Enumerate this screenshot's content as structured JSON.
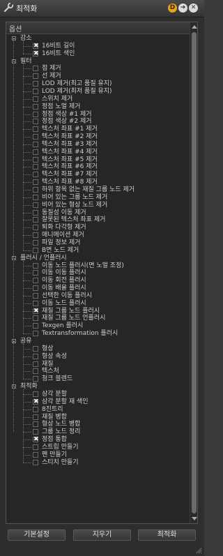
{
  "window": {
    "title": "최적화",
    "btn_d": "D",
    "btn_go": "➜",
    "btn_close": "✕"
  },
  "tree": {
    "header": "옵션",
    "groups": [
      {
        "label": "감소",
        "items": [
          {
            "label": "16비트 길이",
            "checked": true
          },
          {
            "label": "16비트 색인",
            "checked": true
          }
        ]
      },
      {
        "label": "필터",
        "items": [
          {
            "label": "점 제거",
            "checked": false
          },
          {
            "label": "선 제거",
            "checked": false
          },
          {
            "label": "LOD 제거(최고 품질 유지)",
            "checked": false
          },
          {
            "label": "LOD 제거(최저 품질 유지)",
            "checked": false
          },
          {
            "label": "스위치 제거",
            "checked": false
          },
          {
            "label": "정점 노멀 제거",
            "checked": false
          },
          {
            "label": "정점 색상 #1 제거",
            "checked": false
          },
          {
            "label": "정점 색상 #2 제거",
            "checked": false
          },
          {
            "label": "텍스처 좌표 #1 제거",
            "checked": false
          },
          {
            "label": "텍스처 좌표 #2 제거",
            "checked": false
          },
          {
            "label": "텍스처 좌표 #3 제거",
            "checked": false
          },
          {
            "label": "텍스처 좌표 #4 제거",
            "checked": false
          },
          {
            "label": "텍스처 좌표 #5 제거",
            "checked": false
          },
          {
            "label": "텍스처 좌표 #6 제거",
            "checked": false
          },
          {
            "label": "텍스처 좌표 #7 제거",
            "checked": false
          },
          {
            "label": "텍스처 좌표 #8 제거",
            "checked": false
          },
          {
            "label": "하위 항목 없는 재질 그룹 노드 제거",
            "checked": false
          },
          {
            "label": "비어 있는 그룹 노드 제거",
            "checked": false
          },
          {
            "label": "비어 있는 형상 노드 제거",
            "checked": false
          },
          {
            "label": "동질성 이동 제거",
            "checked": false
          },
          {
            "label": "잘못된 텍스처 좌표 제거",
            "checked": false
          },
          {
            "label": "퇴화 다각형 제거",
            "checked": false
          },
          {
            "label": "애니메이션 제거",
            "checked": false
          },
          {
            "label": "파일 정보 제거",
            "checked": false
          },
          {
            "label": "B면 노드 제거",
            "checked": false
          }
        ]
      },
      {
        "label": "플러시 / 언플러시",
        "items": [
          {
            "label": "이동 노드 플러시(면 노멀 조정)",
            "checked": false
          },
          {
            "label": "이동 이동 플러시",
            "checked": false
          },
          {
            "label": "이동 회전 플러시",
            "checked": false
          },
          {
            "label": "이동 배율 플러시",
            "checked": false
          },
          {
            "label": "선택한 이동 플러시",
            "checked": false
          },
          {
            "label": "이동 노드 플러시",
            "checked": false
          },
          {
            "label": "재질 그룹 노드 플러시",
            "checked": true
          },
          {
            "label": "재질 그룹 노드 언플러시",
            "checked": false
          },
          {
            "label": "Texgen 플러시",
            "checked": false
          },
          {
            "label": "Textransformation 플러시",
            "checked": false
          }
        ]
      },
      {
        "label": "공유",
        "items": [
          {
            "label": "형상",
            "checked": false
          },
          {
            "label": "형상 속성",
            "checked": false
          },
          {
            "label": "재질",
            "checked": false
          },
          {
            "label": "텍스처",
            "checked": false
          },
          {
            "label": "청크 블렌드",
            "checked": false
          }
        ]
      },
      {
        "label": "최적화",
        "items": [
          {
            "label": "삼각 분할",
            "checked": false
          },
          {
            "label": "삼각 분할 재 색인",
            "checked": true
          },
          {
            "label": "8진트리",
            "checked": false
          },
          {
            "label": "재질 병합",
            "checked": false
          },
          {
            "label": "형상 노드 병합",
            "checked": false
          },
          {
            "label": "그룹 노드 정리",
            "checked": false
          },
          {
            "label": "정점 통합",
            "checked": true
          },
          {
            "label": "스트립 만들기",
            "checked": false
          },
          {
            "label": "팬 만들기",
            "checked": false
          },
          {
            "label": "스티치 만들기",
            "checked": false
          }
        ]
      }
    ]
  },
  "buttons": {
    "defaults": "기본설정",
    "clear": "지우기",
    "optimize": "최적화"
  },
  "colors": {
    "accent_d": "#e8a11a",
    "panel": "#2e2e2e",
    "tree_bg": "#262626"
  }
}
